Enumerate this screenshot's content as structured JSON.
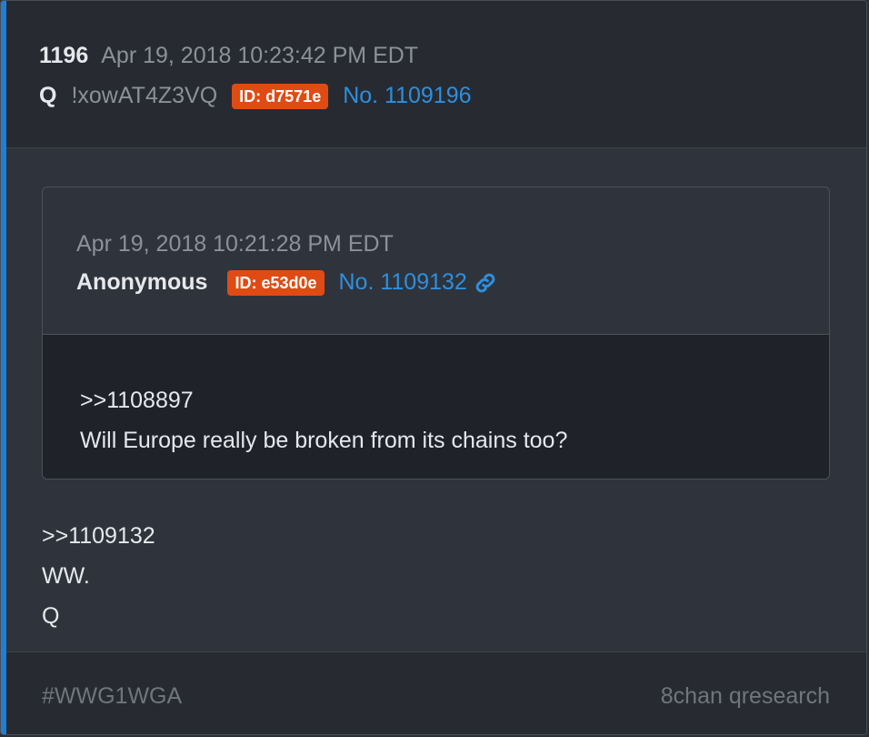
{
  "post": {
    "number": "1196",
    "datetime": "Apr 19, 2018 10:23:42 PM EDT",
    "author": "Q",
    "tripcode": "!xowAT4Z3VQ",
    "id_badge": "ID: d7571e",
    "post_no": "No. 1109196"
  },
  "quoted": {
    "datetime": "Apr 19, 2018 10:21:28 PM EDT",
    "author": "Anonymous",
    "id_badge": "ID: e53d0e",
    "post_no": "No. 1109132",
    "lines": [
      ">>1108897",
      "Will Europe really be broken from its chains too?"
    ]
  },
  "reply": {
    "lines": [
      ">>1109132",
      "WW.",
      "Q"
    ]
  },
  "footer": {
    "hashtag": "#WWG1WGA",
    "source": "8chan qresearch"
  },
  "colors": {
    "accent": "#1e7fd8",
    "badge": "#e04b13",
    "link": "#2d8fe0"
  },
  "icons": {
    "link": "link-icon"
  }
}
